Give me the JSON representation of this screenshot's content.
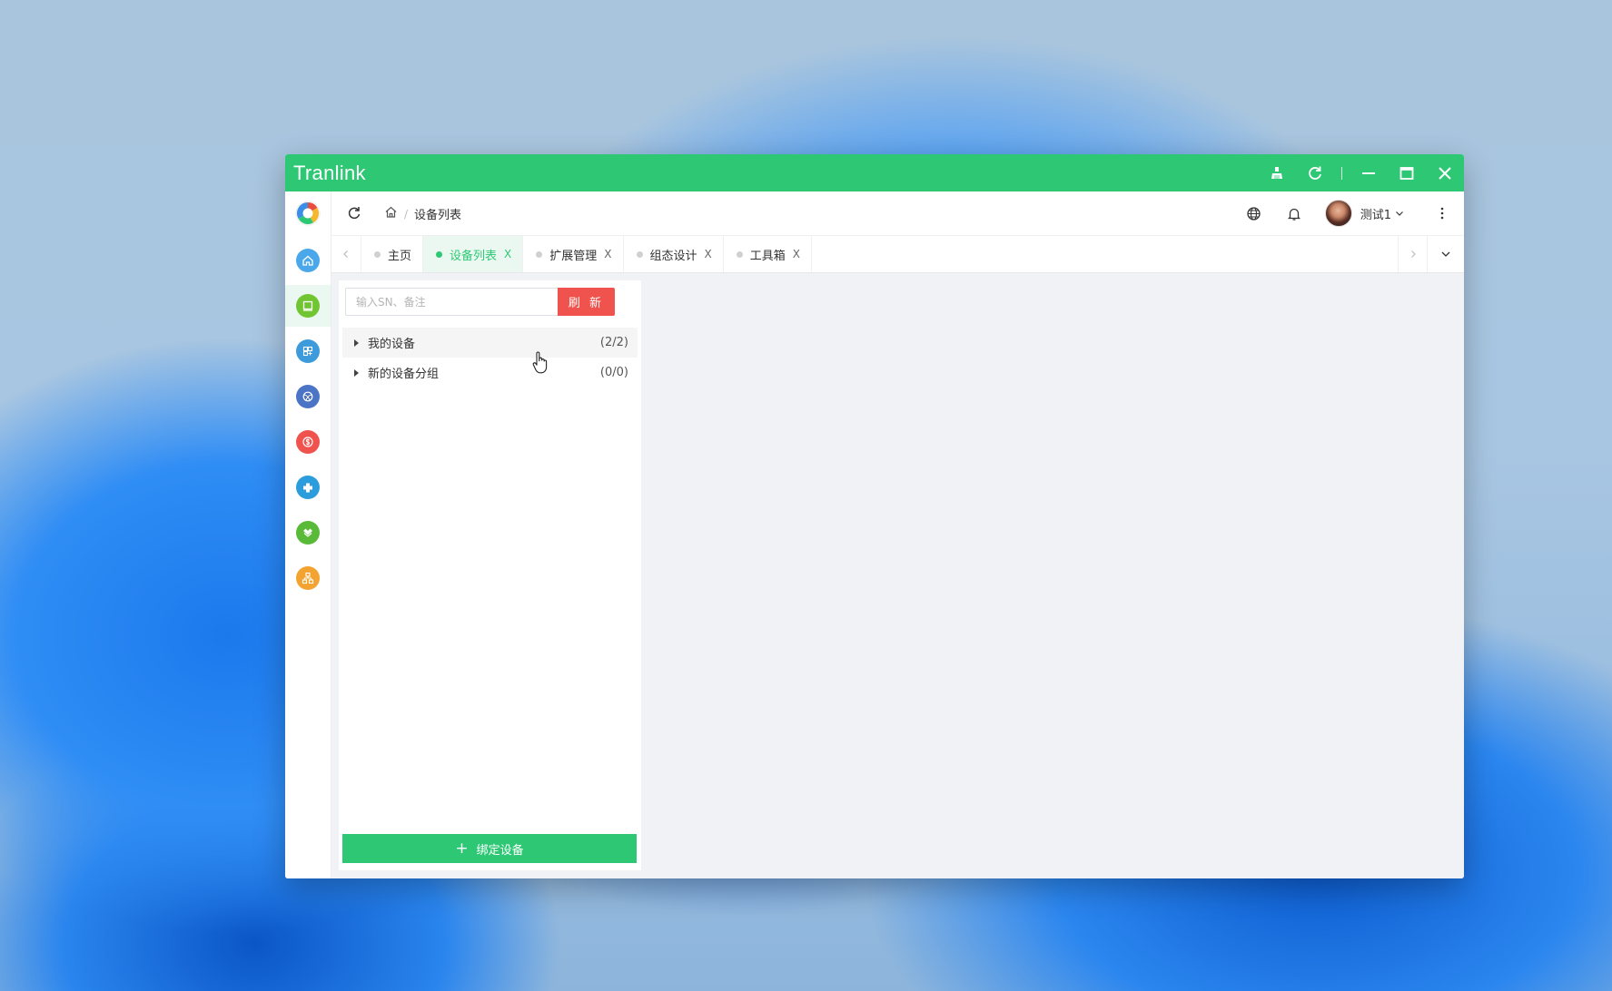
{
  "window": {
    "title": "Tranlink",
    "controls": [
      "broom-icon",
      "refresh-icon",
      "minimize-icon",
      "maximize-icon",
      "close-icon"
    ]
  },
  "sidebar": {
    "items": [
      {
        "name": "home",
        "icon": "home-icon",
        "color": "#4aa8ea"
      },
      {
        "name": "device",
        "icon": "monitor-icon",
        "color": "#71c532",
        "active": true
      },
      {
        "name": "extension",
        "icon": "grid-icon",
        "color": "#3d9bdc"
      },
      {
        "name": "design",
        "icon": "palette-icon",
        "color": "#4c74c6"
      },
      {
        "name": "billing",
        "icon": "dollar-icon",
        "color": "#f0524d"
      },
      {
        "name": "plugins",
        "icon": "puzzle-icon",
        "color": "#2c9ddc"
      },
      {
        "name": "toolbox",
        "icon": "box-icon",
        "color": "#59b939"
      },
      {
        "name": "network",
        "icon": "org-chart-icon",
        "color": "#f2a330"
      }
    ]
  },
  "header": {
    "breadcrumb_current": "设备列表",
    "user_name": "测试1"
  },
  "tabs": [
    {
      "label": "主页",
      "closable": false,
      "active": false
    },
    {
      "label": "设备列表",
      "closable": true,
      "active": true
    },
    {
      "label": "扩展管理",
      "closable": true,
      "active": false
    },
    {
      "label": "组态设计",
      "closable": true,
      "active": false
    },
    {
      "label": "工具箱",
      "closable": true,
      "active": false
    }
  ],
  "tab_close_glyph": "X",
  "panel": {
    "search_placeholder": "输入SN、备注",
    "refresh_label": "刷 新",
    "tree": [
      {
        "label": "我的设备",
        "count": "(2/2)"
      },
      {
        "label": "新的设备分组",
        "count": "(0/0)"
      }
    ],
    "bind_plus": "+",
    "bind_label": "绑定设备"
  },
  "colors": {
    "brand": "#2ec875",
    "danger": "#f0524d",
    "page_bg": "#f0f2f5"
  }
}
